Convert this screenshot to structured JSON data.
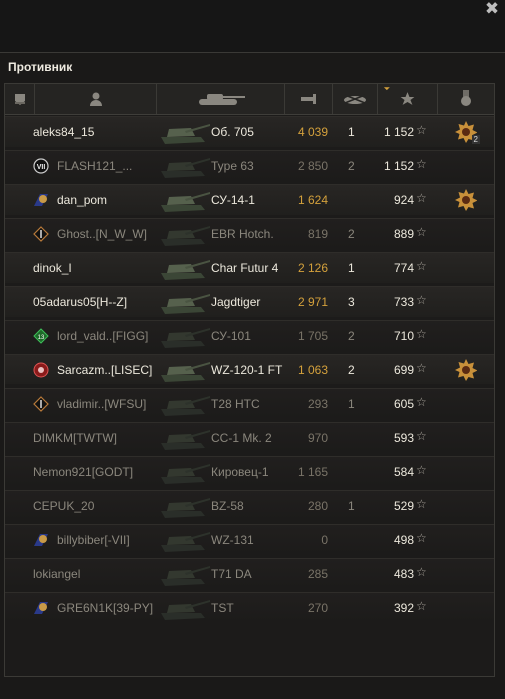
{
  "window": {
    "close_glyph": "✖"
  },
  "panel": {
    "title": "Противник"
  },
  "header": {
    "columns": [
      {
        "icon": "squad-icon"
      },
      {
        "icon": "player-icon"
      },
      {
        "icon": "tank-icon"
      },
      {
        "icon": "damage-icon"
      },
      {
        "icon": "frags-icon"
      },
      {
        "icon": "experience-star-icon",
        "sorted": true
      },
      {
        "icon": "achievements-icon"
      }
    ]
  },
  "rows": [
    {
      "player": "aleks84_15",
      "vehicle": "Об. 705",
      "damage": "4 039",
      "frags": "1",
      "xp": "1 152",
      "badge": "",
      "medal": "gold",
      "medal_count": "2",
      "alive": true
    },
    {
      "player": "FLASH121_...",
      "vehicle": "Type 63",
      "damage": "2 850",
      "frags": "2",
      "xp": "1 152",
      "badge": "VII",
      "medal": "",
      "alive": false
    },
    {
      "player": "dan_pom",
      "vehicle": "СУ-14-1",
      "damage": "1 624",
      "frags": "",
      "xp": "924",
      "badge": "clan-blue",
      "medal": "gold",
      "alive": true
    },
    {
      "player": "Ghost..[N_W_W]",
      "vehicle": "EBR Hotch.",
      "damage": "819",
      "frags": "2",
      "xp": "889",
      "badge": "clan-diamond",
      "medal": "",
      "alive": false
    },
    {
      "player": "dinok_I",
      "vehicle": "Char Futur 4",
      "damage": "2 126",
      "frags": "1",
      "xp": "774",
      "badge": "",
      "medal": "",
      "alive": true
    },
    {
      "player": "05adarus05[H--Z]",
      "vehicle": "Jagdtiger",
      "damage": "2 971",
      "frags": "3",
      "xp": "733",
      "badge": "",
      "medal": "",
      "alive": true
    },
    {
      "player": "lord_vald..[FIGG]",
      "vehicle": "СУ-101",
      "damage": "1 705",
      "frags": "2",
      "xp": "710",
      "badge": "clan-green",
      "medal": "",
      "alive": false
    },
    {
      "player": "Sarcazm..[LISEC]",
      "vehicle": "WZ-120-1 FT",
      "damage": "1 063",
      "frags": "2",
      "xp": "699",
      "badge": "clan-red",
      "medal": "gold",
      "alive": true
    },
    {
      "player": "vladimir..[WFSU]",
      "vehicle": "T28 HTC",
      "damage": "293",
      "frags": "1",
      "xp": "605",
      "badge": "clan-diamond",
      "medal": "",
      "alive": false
    },
    {
      "player": "DIMKM[TWTW]",
      "vehicle": "CC-1 Mk. 2",
      "damage": "970",
      "frags": "",
      "xp": "593",
      "badge": "",
      "medal": "",
      "alive": false
    },
    {
      "player": "Nemon921[GODT]",
      "vehicle": "Кировец-1",
      "damage": "1 165",
      "frags": "",
      "xp": "584",
      "badge": "",
      "medal": "",
      "alive": false
    },
    {
      "player": "CEPUK_20",
      "vehicle": "BZ-58",
      "damage": "280",
      "frags": "1",
      "xp": "529",
      "badge": "",
      "medal": "",
      "alive": false
    },
    {
      "player": "billybiber[-VII]",
      "vehicle": "WZ-131",
      "damage": "0",
      "frags": "",
      "xp": "498",
      "badge": "clan-blue",
      "medal": "",
      "alive": false
    },
    {
      "player": "lokiangel",
      "vehicle": "T71 DA",
      "damage": "285",
      "frags": "",
      "xp": "483",
      "badge": "",
      "medal": "",
      "alive": false
    },
    {
      "player": "GRE6N1K[39-PY]",
      "vehicle": "TST",
      "damage": "270",
      "frags": "",
      "xp": "392",
      "badge": "clan-blue",
      "medal": "",
      "alive": false
    }
  ],
  "colors": {
    "damage_alive": "#d4a13c",
    "damage_dead": "#7a7468",
    "medal_gold": "#c8903a"
  }
}
